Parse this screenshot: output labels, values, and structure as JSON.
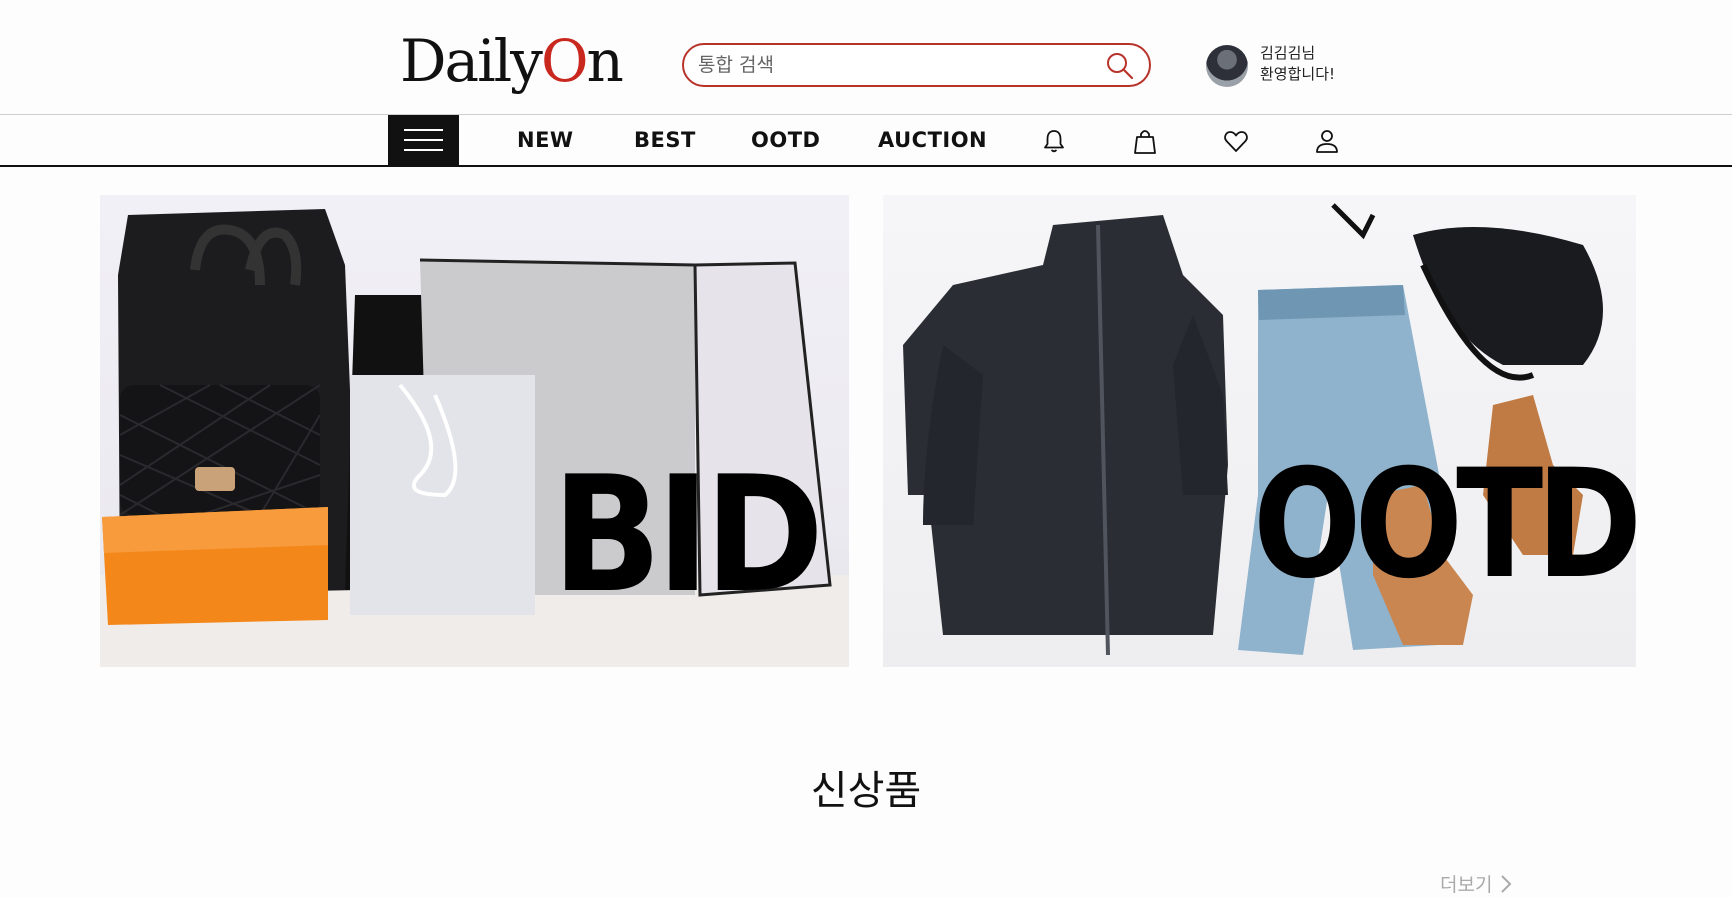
{
  "header": {
    "logo_prefix": "Daily",
    "logo_o": "O",
    "logo_suffix": "n",
    "search_placeholder": "통합 검색",
    "user_line1": "김김김님",
    "user_line2": "환영합니다!"
  },
  "nav": {
    "links": [
      "NEW",
      "BEST",
      "OOTD",
      "AUCTION"
    ],
    "icons": [
      "menu-icon",
      "bell-icon",
      "bag-icon",
      "heart-icon",
      "user-icon"
    ]
  },
  "banners": {
    "left_text": "BID",
    "right_text": "OOTD"
  },
  "section": {
    "title": "신상품",
    "more": "더보기"
  },
  "colors": {
    "accent": "#b8332a",
    "logo_o": "#c8281e"
  }
}
